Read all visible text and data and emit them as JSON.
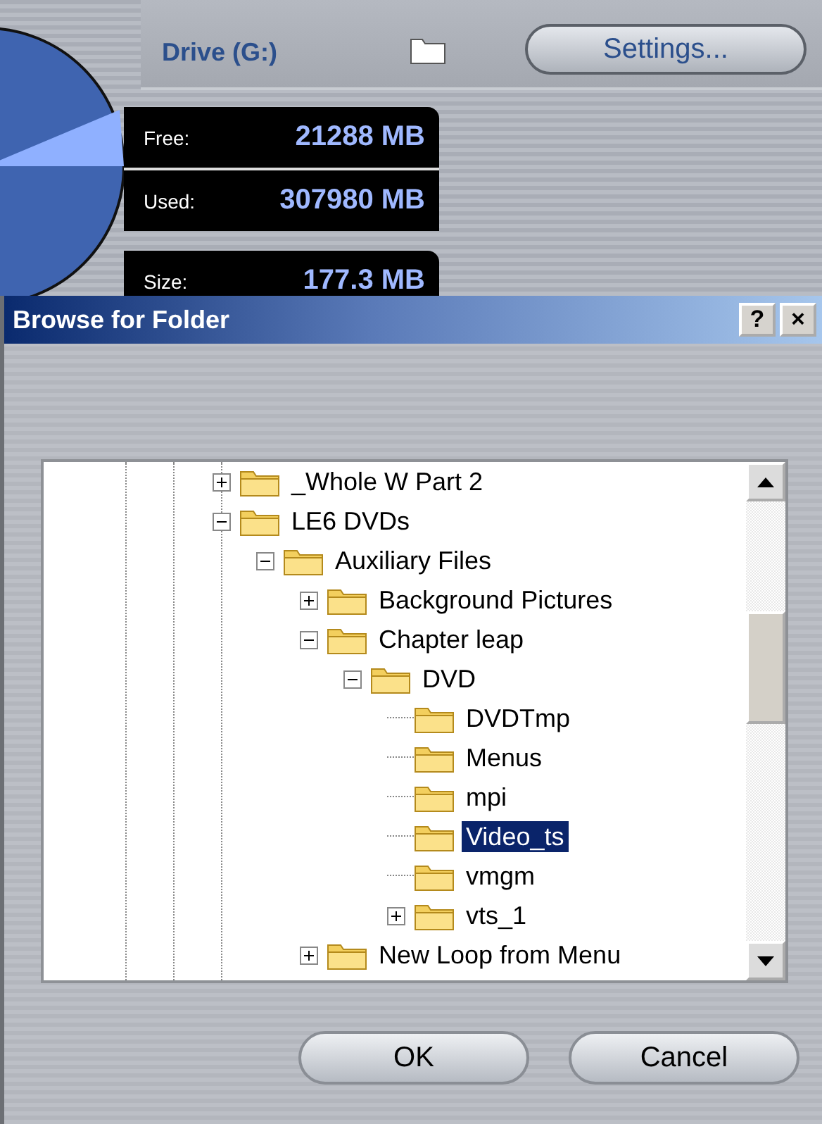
{
  "drive_panel": {
    "drive_label": "Drive (G:)",
    "settings_button": "Settings...",
    "stats": [
      {
        "label": "Free:",
        "value": "21288 MB"
      },
      {
        "label": "Used:",
        "value": "307980 MB"
      },
      {
        "label": "Size:",
        "value": "177.3 MB"
      }
    ]
  },
  "dialog": {
    "title": "Browse for Folder",
    "title_buttons": [
      "?",
      "×"
    ],
    "tree": [
      {
        "label": "_Whole W Part 2",
        "kind": "branch",
        "expanded": false,
        "selected": false
      },
      {
        "label": "LE6 DVDs",
        "kind": "branch",
        "expanded": true,
        "selected": false,
        "children": [
          {
            "label": "Auxiliary Files",
            "kind": "branch",
            "expanded": true,
            "selected": false,
            "children": [
              {
                "label": "Background Pictures",
                "kind": "branch",
                "expanded": false,
                "selected": false
              },
              {
                "label": "Chapter leap",
                "kind": "branch",
                "expanded": true,
                "selected": false,
                "children": [
                  {
                    "label": "DVD",
                    "kind": "branch",
                    "expanded": true,
                    "selected": false,
                    "children": [
                      {
                        "label": "DVDTmp",
                        "kind": "leaf",
                        "selected": false
                      },
                      {
                        "label": "Menus",
                        "kind": "leaf",
                        "selected": false
                      },
                      {
                        "label": "mpi",
                        "kind": "leaf",
                        "selected": false
                      },
                      {
                        "label": "Video_ts",
                        "kind": "leaf",
                        "selected": true
                      },
                      {
                        "label": "vmgm",
                        "kind": "leaf",
                        "selected": false
                      },
                      {
                        "label": "vts_1",
                        "kind": "branch",
                        "expanded": false,
                        "selected": false
                      }
                    ]
                  }
                ]
              },
              {
                "label": "New Loop from Menu",
                "kind": "branch",
                "expanded": false,
                "selected": false
              }
            ]
          }
        ]
      }
    ],
    "buttons": [
      "OK",
      "Cancel"
    ]
  }
}
